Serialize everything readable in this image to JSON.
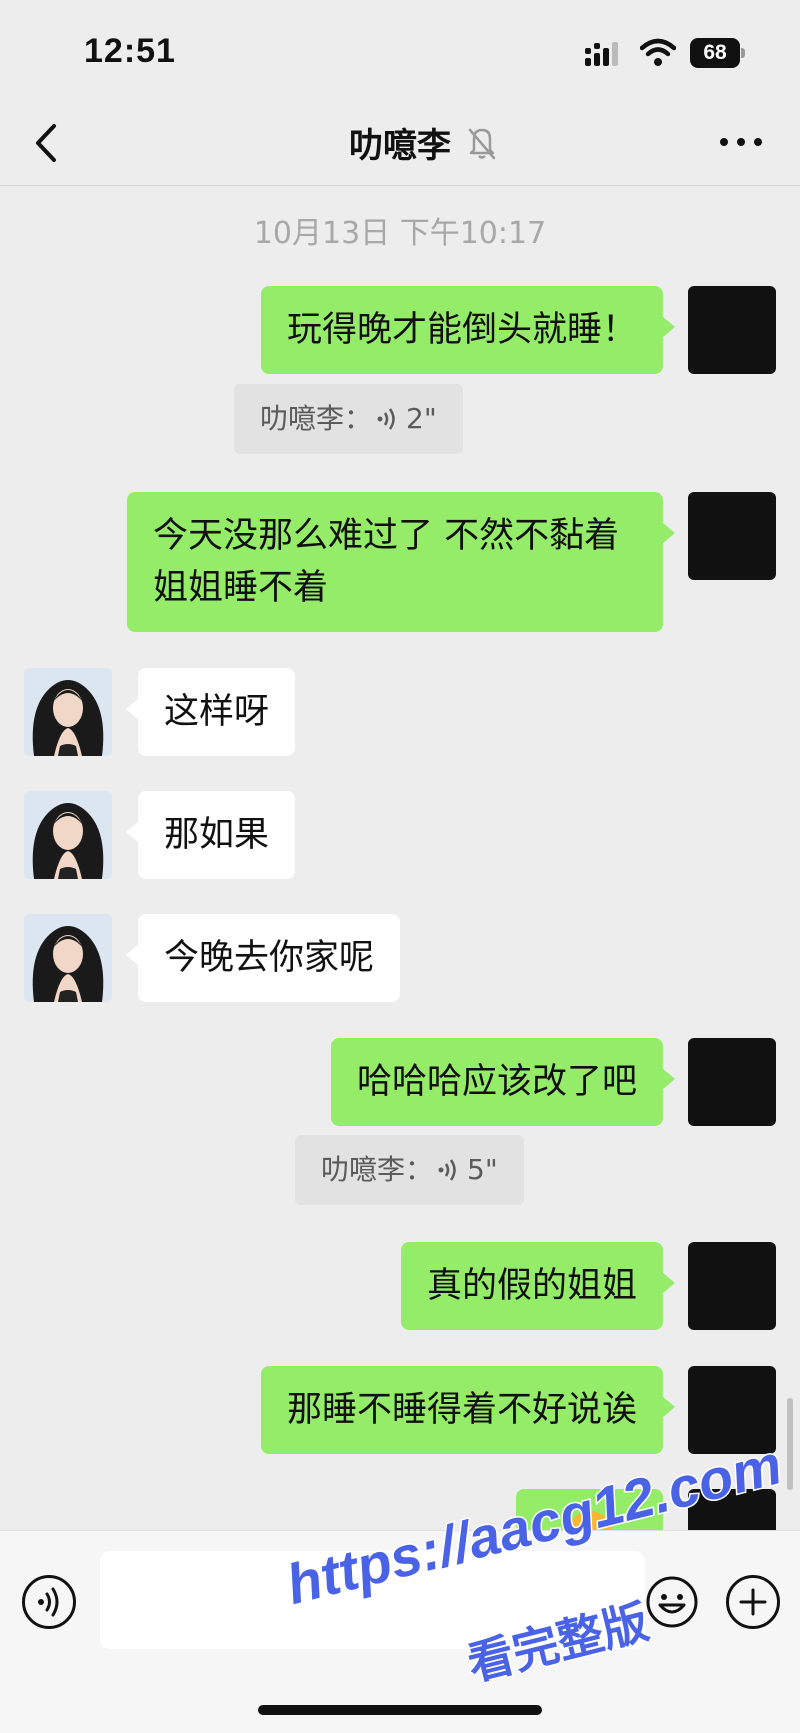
{
  "status_bar": {
    "time": "12:51",
    "battery": "68"
  },
  "nav": {
    "title": "叻噫李"
  },
  "chat": {
    "timestamp": "10月13日 下午10:17",
    "messages": [
      {
        "text": "玩得晚才能倒头就睡！"
      },
      {
        "quote_sender": "叻噫李：",
        "quote_duration": "2\""
      },
      {
        "text": "今天没那么难过了 不然不黏着姐姐睡不着"
      },
      {
        "text": "这样呀"
      },
      {
        "text": "那如果"
      },
      {
        "text": "今晚去你家呢"
      },
      {
        "text": "哈哈哈应该改了吧"
      },
      {
        "quote_sender": "叻噫李：",
        "quote_duration": "5\""
      },
      {
        "text": "真的假的姐姐"
      },
      {
        "text": "那睡不睡得着不好说诶"
      }
    ]
  },
  "watermark": {
    "line1": "https://aacg12.com",
    "line2": "看完整版"
  },
  "colors": {
    "sent_bubble": "#95ec69",
    "received_bubble": "#ffffff",
    "background": "#ededed"
  }
}
